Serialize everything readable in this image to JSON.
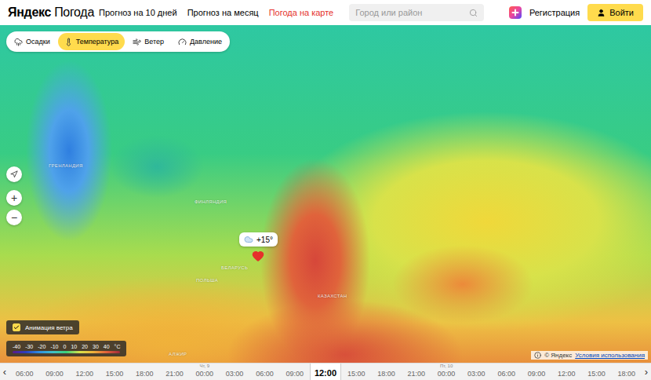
{
  "header": {
    "logo": {
      "brand": "Яндекс",
      "product": "Погода"
    },
    "nav": [
      {
        "label": "Прогноз на 10 дней",
        "selected": false
      },
      {
        "label": "Прогноз на месяц",
        "selected": false
      },
      {
        "label": "Погода на карте",
        "selected": true
      }
    ],
    "search": {
      "placeholder": "Город или район"
    },
    "register": "Регистрация",
    "login": "Войти"
  },
  "layers": [
    {
      "label": "Осадки",
      "icon": "precipitation",
      "selected": false
    },
    {
      "label": "Температура",
      "icon": "temperature",
      "selected": true
    },
    {
      "label": "Ветер",
      "icon": "wind",
      "selected": false
    },
    {
      "label": "Давление",
      "icon": "pressure",
      "selected": false
    }
  ],
  "map_controls": {
    "zoom_in": "+",
    "zoom_out": "−"
  },
  "pin": {
    "temperature": "+15°"
  },
  "map_labels": [
    "ГРЕНЛАНДИЯ",
    "ФИНЛЯНДИЯ",
    "БЕЛАРУСЬ",
    "ПОЛЬША",
    "КАЗАХСТАН",
    "АЛЖИР"
  ],
  "wind_animation": {
    "label": "Анимация ветра",
    "checked": true
  },
  "legend": {
    "ticks": [
      "-40",
      "-30",
      "-20",
      "-10",
      "0",
      "10",
      "20",
      "30",
      "40"
    ],
    "unit": "°C"
  },
  "attribution": {
    "copyright": "© Яндекс",
    "link": "Условия использования"
  },
  "timeline": {
    "prev": "‹",
    "next": "›",
    "slots": [
      {
        "time": "06:00",
        "day": "",
        "selected": false
      },
      {
        "time": "09:00",
        "day": "",
        "selected": false
      },
      {
        "time": "12:00",
        "day": "",
        "selected": false
      },
      {
        "time": "15:00",
        "day": "",
        "selected": false
      },
      {
        "time": "18:00",
        "day": "",
        "selected": false
      },
      {
        "time": "21:00",
        "day": "",
        "selected": false
      },
      {
        "time": "00:00",
        "day": "Чт, 9",
        "selected": false
      },
      {
        "time": "03:00",
        "day": "",
        "selected": false
      },
      {
        "time": "06:00",
        "day": "",
        "selected": false
      },
      {
        "time": "09:00",
        "day": "",
        "selected": false
      },
      {
        "time": "12:00",
        "day": "",
        "selected": true
      },
      {
        "time": "15:00",
        "day": "",
        "selected": false
      },
      {
        "time": "18:00",
        "day": "",
        "selected": false
      },
      {
        "time": "21:00",
        "day": "",
        "selected": false
      },
      {
        "time": "00:00",
        "day": "Пт, 10",
        "selected": false
      },
      {
        "time": "03:00",
        "day": "",
        "selected": false
      },
      {
        "time": "06:00",
        "day": "",
        "selected": false
      },
      {
        "time": "09:00",
        "day": "",
        "selected": false
      },
      {
        "time": "12:00",
        "day": "",
        "selected": false
      },
      {
        "time": "15:00",
        "day": "",
        "selected": false
      },
      {
        "time": "18:00",
        "day": "",
        "selected": false
      }
    ]
  }
}
